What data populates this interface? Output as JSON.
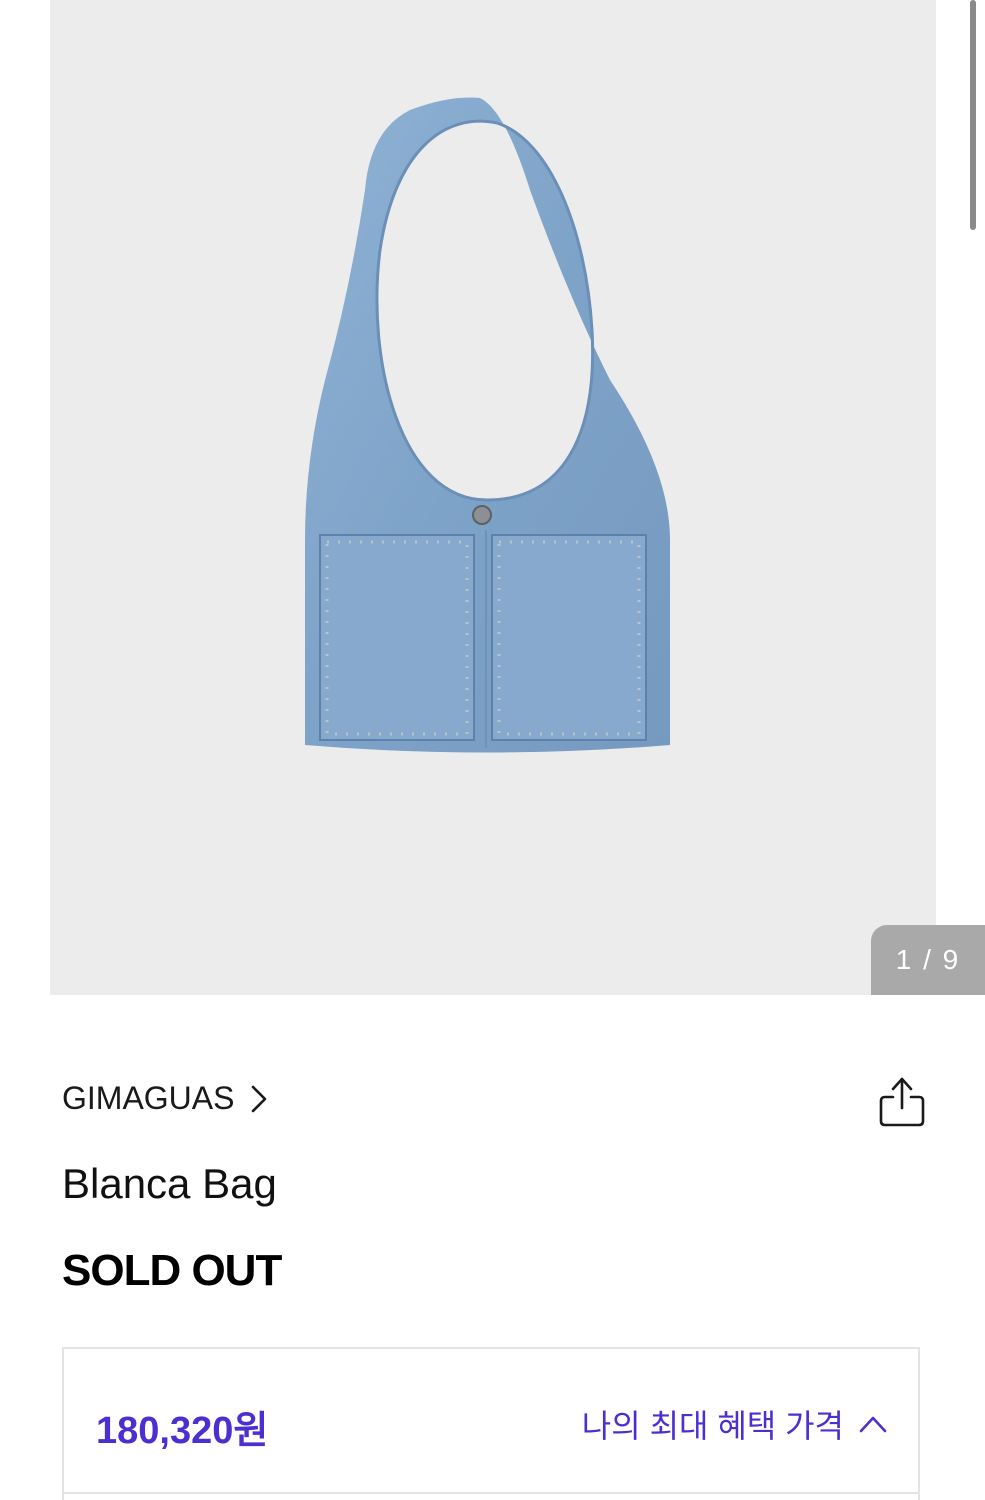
{
  "gallery": {
    "counter": "1 / 9",
    "image_alt": "denim shoulder bag with studded pockets",
    "bg_color": "#ececec"
  },
  "product": {
    "brand": "GIMAGUAS",
    "name": "Blanca Bag",
    "status": "SOLD OUT"
  },
  "benefit": {
    "price": "180,320원",
    "toggle_label": "나의 최대 혜택 가격",
    "accent_color": "#4a2fd1"
  },
  "icons": {
    "brand_chevron": "chevron-right-icon",
    "share": "share-icon",
    "toggle": "chevron-up-icon"
  }
}
